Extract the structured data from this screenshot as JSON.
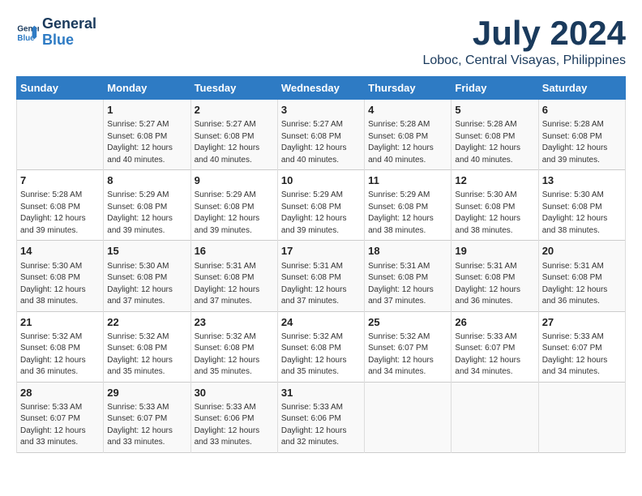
{
  "logo": {
    "line1": "General",
    "line2": "Blue"
  },
  "title": "July 2024",
  "subtitle": "Loboc, Central Visayas, Philippines",
  "days": [
    "Sunday",
    "Monday",
    "Tuesday",
    "Wednesday",
    "Thursday",
    "Friday",
    "Saturday"
  ],
  "weeks": [
    [
      {
        "day": "",
        "content": ""
      },
      {
        "day": "1",
        "content": "Sunrise: 5:27 AM\nSunset: 6:08 PM\nDaylight: 12 hours\nand 40 minutes."
      },
      {
        "day": "2",
        "content": "Sunrise: 5:27 AM\nSunset: 6:08 PM\nDaylight: 12 hours\nand 40 minutes."
      },
      {
        "day": "3",
        "content": "Sunrise: 5:27 AM\nSunset: 6:08 PM\nDaylight: 12 hours\nand 40 minutes."
      },
      {
        "day": "4",
        "content": "Sunrise: 5:28 AM\nSunset: 6:08 PM\nDaylight: 12 hours\nand 40 minutes."
      },
      {
        "day": "5",
        "content": "Sunrise: 5:28 AM\nSunset: 6:08 PM\nDaylight: 12 hours\nand 40 minutes."
      },
      {
        "day": "6",
        "content": "Sunrise: 5:28 AM\nSunset: 6:08 PM\nDaylight: 12 hours\nand 39 minutes."
      }
    ],
    [
      {
        "day": "7",
        "content": "Sunrise: 5:28 AM\nSunset: 6:08 PM\nDaylight: 12 hours\nand 39 minutes."
      },
      {
        "day": "8",
        "content": "Sunrise: 5:29 AM\nSunset: 6:08 PM\nDaylight: 12 hours\nand 39 minutes."
      },
      {
        "day": "9",
        "content": "Sunrise: 5:29 AM\nSunset: 6:08 PM\nDaylight: 12 hours\nand 39 minutes."
      },
      {
        "day": "10",
        "content": "Sunrise: 5:29 AM\nSunset: 6:08 PM\nDaylight: 12 hours\nand 39 minutes."
      },
      {
        "day": "11",
        "content": "Sunrise: 5:29 AM\nSunset: 6:08 PM\nDaylight: 12 hours\nand 38 minutes."
      },
      {
        "day": "12",
        "content": "Sunrise: 5:30 AM\nSunset: 6:08 PM\nDaylight: 12 hours\nand 38 minutes."
      },
      {
        "day": "13",
        "content": "Sunrise: 5:30 AM\nSunset: 6:08 PM\nDaylight: 12 hours\nand 38 minutes."
      }
    ],
    [
      {
        "day": "14",
        "content": "Sunrise: 5:30 AM\nSunset: 6:08 PM\nDaylight: 12 hours\nand 38 minutes."
      },
      {
        "day": "15",
        "content": "Sunrise: 5:30 AM\nSunset: 6:08 PM\nDaylight: 12 hours\nand 37 minutes."
      },
      {
        "day": "16",
        "content": "Sunrise: 5:31 AM\nSunset: 6:08 PM\nDaylight: 12 hours\nand 37 minutes."
      },
      {
        "day": "17",
        "content": "Sunrise: 5:31 AM\nSunset: 6:08 PM\nDaylight: 12 hours\nand 37 minutes."
      },
      {
        "day": "18",
        "content": "Sunrise: 5:31 AM\nSunset: 6:08 PM\nDaylight: 12 hours\nand 37 minutes."
      },
      {
        "day": "19",
        "content": "Sunrise: 5:31 AM\nSunset: 6:08 PM\nDaylight: 12 hours\nand 36 minutes."
      },
      {
        "day": "20",
        "content": "Sunrise: 5:31 AM\nSunset: 6:08 PM\nDaylight: 12 hours\nand 36 minutes."
      }
    ],
    [
      {
        "day": "21",
        "content": "Sunrise: 5:32 AM\nSunset: 6:08 PM\nDaylight: 12 hours\nand 36 minutes."
      },
      {
        "day": "22",
        "content": "Sunrise: 5:32 AM\nSunset: 6:08 PM\nDaylight: 12 hours\nand 35 minutes."
      },
      {
        "day": "23",
        "content": "Sunrise: 5:32 AM\nSunset: 6:08 PM\nDaylight: 12 hours\nand 35 minutes."
      },
      {
        "day": "24",
        "content": "Sunrise: 5:32 AM\nSunset: 6:08 PM\nDaylight: 12 hours\nand 35 minutes."
      },
      {
        "day": "25",
        "content": "Sunrise: 5:32 AM\nSunset: 6:07 PM\nDaylight: 12 hours\nand 34 minutes."
      },
      {
        "day": "26",
        "content": "Sunrise: 5:33 AM\nSunset: 6:07 PM\nDaylight: 12 hours\nand 34 minutes."
      },
      {
        "day": "27",
        "content": "Sunrise: 5:33 AM\nSunset: 6:07 PM\nDaylight: 12 hours\nand 34 minutes."
      }
    ],
    [
      {
        "day": "28",
        "content": "Sunrise: 5:33 AM\nSunset: 6:07 PM\nDaylight: 12 hours\nand 33 minutes."
      },
      {
        "day": "29",
        "content": "Sunrise: 5:33 AM\nSunset: 6:07 PM\nDaylight: 12 hours\nand 33 minutes."
      },
      {
        "day": "30",
        "content": "Sunrise: 5:33 AM\nSunset: 6:06 PM\nDaylight: 12 hours\nand 33 minutes."
      },
      {
        "day": "31",
        "content": "Sunrise: 5:33 AM\nSunset: 6:06 PM\nDaylight: 12 hours\nand 32 minutes."
      },
      {
        "day": "",
        "content": ""
      },
      {
        "day": "",
        "content": ""
      },
      {
        "day": "",
        "content": ""
      }
    ]
  ]
}
